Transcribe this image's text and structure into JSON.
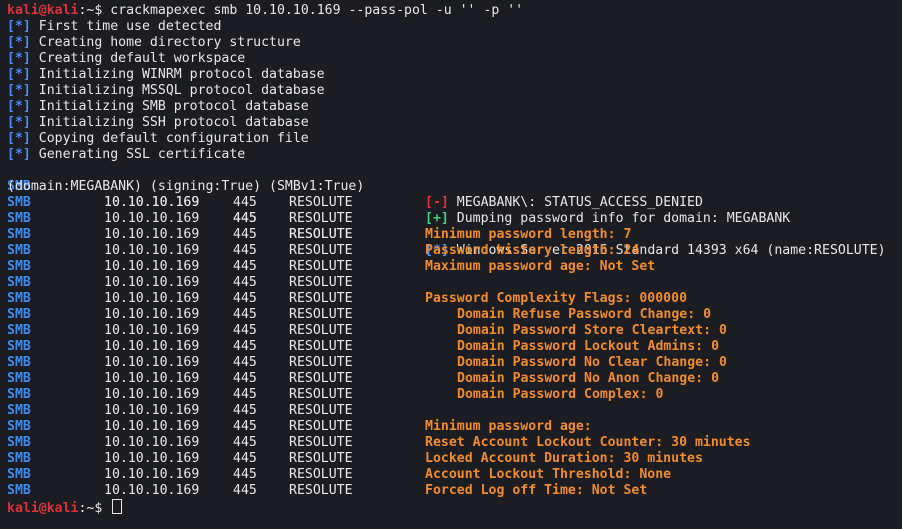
{
  "prompt": {
    "user_host": "kali@kali",
    "path": ":~",
    "symbol": "$",
    "command": "crackmapexec smb 10.10.10.169 --pass-pol -u '' -p ''"
  },
  "init": [
    {
      "mark": "[*]",
      "text": "First time use detected"
    },
    {
      "mark": "[*]",
      "text": "Creating home directory structure"
    },
    {
      "mark": "[*]",
      "text": "Creating default workspace"
    },
    {
      "mark": "[*]",
      "text": "Initializing WINRM protocol database"
    },
    {
      "mark": "[*]",
      "text": "Initializing MSSQL protocol database"
    },
    {
      "mark": "[*]",
      "text": "Initializing SMB protocol database"
    },
    {
      "mark": "[*]",
      "text": "Initializing SSH protocol database"
    },
    {
      "mark": "[*]",
      "text": "Copying default configuration file"
    },
    {
      "mark": "[*]",
      "text": "Generating SSL certificate"
    }
  ],
  "smb": {
    "proto": "SMB",
    "ip": "10.10.10.169",
    "port": "445",
    "host": "RESOLUTE"
  },
  "os_line": {
    "mark": "[*]",
    "text": "Windows Server 2016 Standard 14393 x64 (name:RESOLUTE)"
  },
  "wrap_line": "(domain:MEGABANK) (signing:True) (SMBv1:True)",
  "denied": {
    "mark": "[-]",
    "text": "MEGABANK\\: STATUS_ACCESS_DENIED"
  },
  "dumping": {
    "mark": "[+]",
    "text": "Dumping password info for domain: MEGABANK"
  },
  "policy": [
    {
      "text": "Minimum password length: 7",
      "indent": false
    },
    {
      "text": "Password history length: 24",
      "indent": false
    },
    {
      "text": "Maximum password age: Not Set",
      "indent": false
    },
    {
      "text": "",
      "indent": false
    },
    {
      "text": "Password Complexity Flags: 000000",
      "indent": false
    },
    {
      "text": "Domain Refuse Password Change: 0",
      "indent": true
    },
    {
      "text": "Domain Password Store Cleartext: 0",
      "indent": true
    },
    {
      "text": "Domain Password Lockout Admins: 0",
      "indent": true
    },
    {
      "text": "Domain Password No Clear Change: 0",
      "indent": true
    },
    {
      "text": "Domain Password No Anon Change: 0",
      "indent": true
    },
    {
      "text": "Domain Password Complex: 0",
      "indent": true
    },
    {
      "text": "",
      "indent": false
    },
    {
      "text": "Minimum password age:",
      "indent": false
    },
    {
      "text": "Reset Account Lockout Counter: 30 minutes",
      "indent": false
    },
    {
      "text": "Locked Account Duration: 30 minutes",
      "indent": false
    },
    {
      "text": "Account Lockout Threshold: None",
      "indent": false
    },
    {
      "text": "Forced Log off Time: Not Set",
      "indent": false
    }
  ],
  "colors": {
    "background": "#1b1d22",
    "prompt_red": "#e0303a",
    "info_blue": "#4aa3ff",
    "success_green": "#46d07a",
    "policy_orange": "#f28b2c"
  }
}
